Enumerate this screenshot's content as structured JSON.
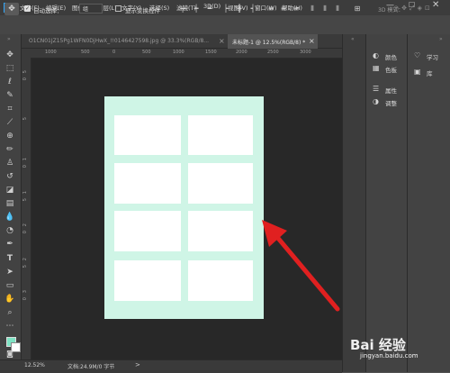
{
  "menubar": {
    "logo": "Ps",
    "items": [
      "文件(F)",
      "编辑(E)",
      "图像(I)",
      "图层(L)",
      "文字(Y)",
      "选择(S)",
      "滤镜(T)",
      "3D(D)",
      "视图(V)",
      "窗口(W)",
      "帮助(H)"
    ],
    "window_controls": {
      "minimize": "—",
      "maximize": "☐",
      "close": "✕"
    }
  },
  "options": {
    "auto_select_label": "自动选择：",
    "auto_select_checked": true,
    "group_select_value": "组",
    "show_transform_label": "显示变换控件",
    "mode_3d_label": "3D 模式："
  },
  "tabs": [
    {
      "label": "O1CN01JZ15Pg1WFN0DjHwX_!!0146427598.jpg @ 33.3%(RGB/8...",
      "close": "×",
      "active": false
    },
    {
      "label": "未标题-1 @ 12.5%(RGB/8) *",
      "close": "×",
      "active": true
    }
  ],
  "ruler": {
    "top_labels": [
      "1000",
      "500",
      "0",
      "500",
      "1000",
      "1500",
      "2000",
      "2500",
      "3000"
    ],
    "left_labels": [
      "5",
      "0",
      "5",
      "1",
      "0",
      "1",
      "5",
      "2",
      "0",
      "2",
      "5",
      "3",
      "0"
    ]
  },
  "status": {
    "zoom": "12.52%",
    "doc_info": "文档:24.9M/0 字节",
    "arrow": ">"
  },
  "panels": {
    "group1": [
      {
        "icon": "color-wheel-icon",
        "glyph": "◐",
        "label": "颜色"
      },
      {
        "icon": "swatches-icon",
        "glyph": "▦",
        "label": "色板"
      }
    ],
    "group2": [
      {
        "icon": "properties-icon",
        "glyph": "☰",
        "label": "属性"
      },
      {
        "icon": "adjustments-icon",
        "glyph": "◑",
        "label": "调整"
      }
    ],
    "far": [
      {
        "icon": "bulb-icon",
        "glyph": "♡",
        "label": "学习"
      },
      {
        "icon": "library-icon",
        "glyph": "▣",
        "label": "库"
      }
    ]
  },
  "canvas": {
    "page_color": "#cff5e6",
    "card_color": "#ffffff",
    "card_rows": 4,
    "card_cols": 2,
    "background": "#282828"
  },
  "annotation": {
    "color": "#e02020"
  },
  "watermark": {
    "text": "Bai 经验",
    "domain": "jingyan.baidu.com"
  }
}
